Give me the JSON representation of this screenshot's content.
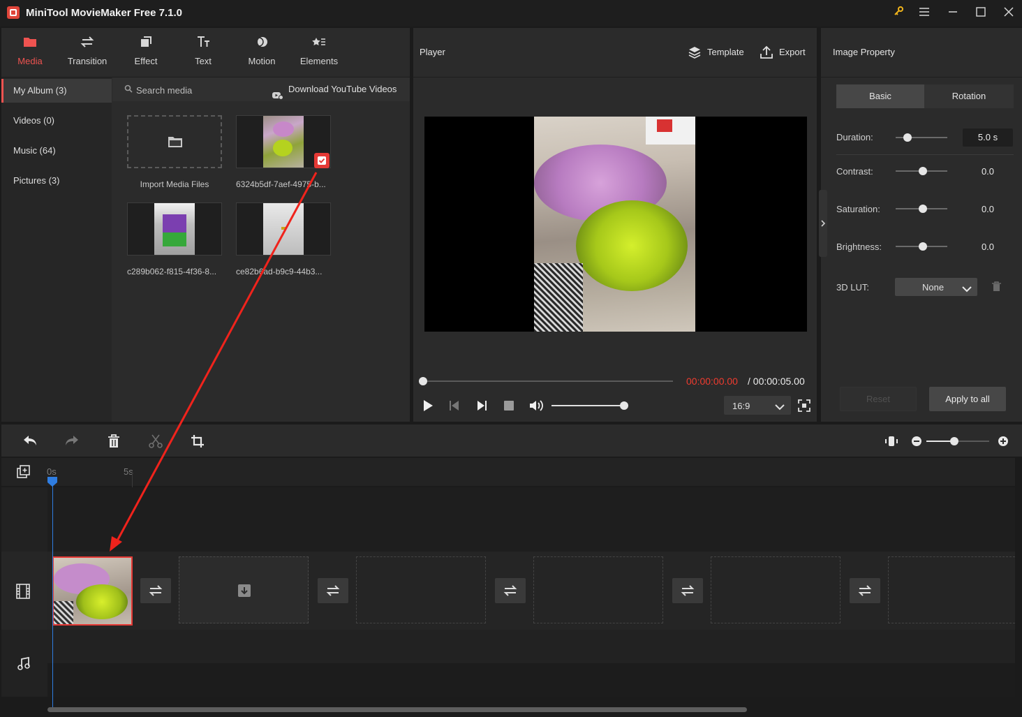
{
  "app": {
    "title": "MiniTool MovieMaker Free 7.1.0"
  },
  "toolbar": {
    "tabs": [
      {
        "label": "Media",
        "icon": "folder-icon",
        "active": true
      },
      {
        "label": "Transition",
        "icon": "swap-icon"
      },
      {
        "label": "Effect",
        "icon": "effect-icon"
      },
      {
        "label": "Text",
        "icon": "text-icon"
      },
      {
        "label": "Motion",
        "icon": "motion-icon"
      },
      {
        "label": "Elements",
        "icon": "elements-icon"
      }
    ]
  },
  "album_nav": {
    "items": [
      {
        "label": "My Album (3)",
        "active": true
      },
      {
        "label": "Videos (0)"
      },
      {
        "label": "Music (64)"
      },
      {
        "label": "Pictures (3)"
      }
    ]
  },
  "search": {
    "placeholder": "Search media",
    "download_label": "Download YouTube Videos"
  },
  "media": {
    "import_label": "Import Media Files",
    "items": [
      {
        "name": "6324b5df-7aef-4975-b...",
        "selected": true
      },
      {
        "name": "c289b062-f815-4f36-8..."
      },
      {
        "name": "ce82b6ad-b9c9-44b3..."
      }
    ]
  },
  "player": {
    "title": "Player",
    "template_label": "Template",
    "export_label": "Export",
    "current_time": "00:00:00.00",
    "total_time": "/ 00:00:05.00",
    "aspect_ratio": "16:9",
    "progress": 0.0,
    "volume": 1.0
  },
  "property": {
    "title": "Image Property",
    "tabs": [
      "Basic",
      "Rotation"
    ],
    "duration_label": "Duration:",
    "duration_value": "5.0 s",
    "contrast_label": "Contrast:",
    "contrast_value": "0.0",
    "saturation_label": "Saturation:",
    "saturation_value": "0.0",
    "brightness_label": "Brightness:",
    "brightness_value": "0.0",
    "lut_label": "3D LUT:",
    "lut_value": "None",
    "reset_label": "Reset",
    "apply_label": "Apply to all"
  },
  "timeline": {
    "ruler": [
      "0s",
      "5s"
    ]
  },
  "colors": {
    "accent": "#ef5350",
    "playhead": "#2f7de1",
    "annotation_arrow": "#f0231c"
  }
}
